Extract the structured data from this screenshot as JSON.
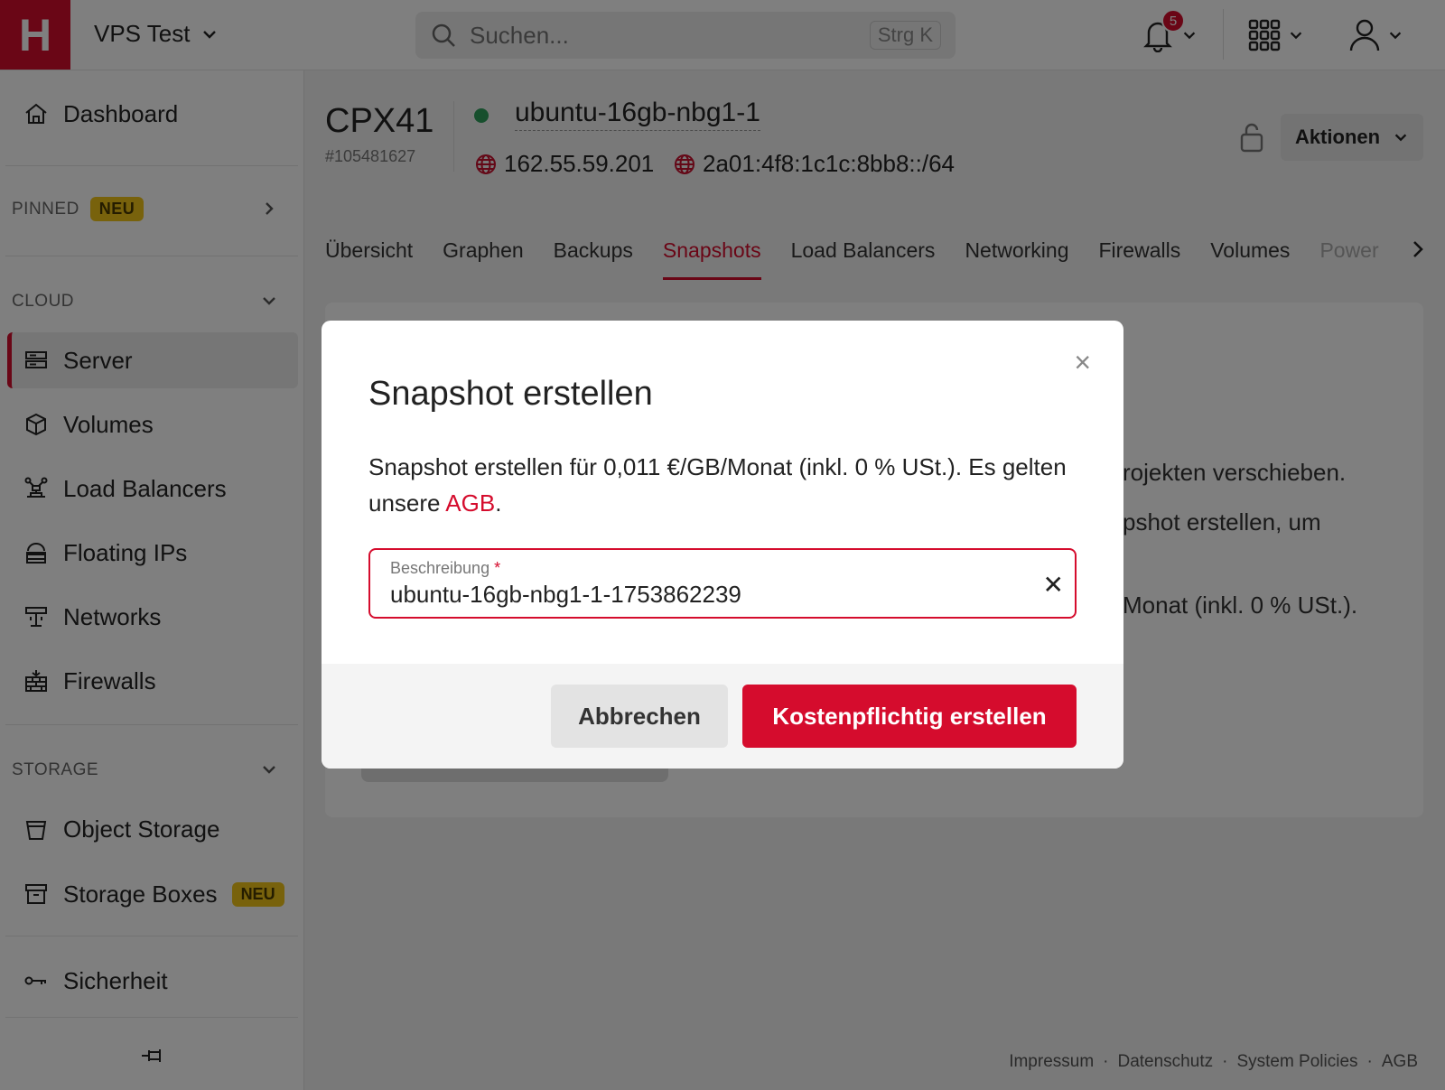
{
  "topbar": {
    "logo_letter": "H",
    "project_name": "VPS Test",
    "search_placeholder": "Suchen...",
    "search_shortcut": "Strg K",
    "notification_count": "5"
  },
  "sidebar": {
    "dashboard": "Dashboard",
    "pinned_label": "PINNED",
    "pinned_badge": "NEU",
    "cloud_label": "CLOUD",
    "cloud_items": [
      "Server",
      "Volumes",
      "Load Balancers",
      "Floating IPs",
      "Networks",
      "Firewalls"
    ],
    "storage_label": "STORAGE",
    "storage_items": [
      "Object Storage",
      "Storage Boxes"
    ],
    "storage_boxes_badge": "NEU",
    "security": "Sicherheit"
  },
  "server": {
    "type": "CPX41",
    "id": "#105481627",
    "name": "ubuntu-16gb-nbg1-1",
    "ipv4": "162.55.59.201",
    "ipv6": "2a01:4f8:1c1c:8bb8::/64",
    "actions_label": "Aktionen"
  },
  "tabs": [
    "Übersicht",
    "Graphen",
    "Backups",
    "Snapshots",
    "Load Balancers",
    "Networking",
    "Firewalls",
    "Volumes",
    "Power"
  ],
  "background_text": {
    "line1": "rojekten verschieben.",
    "line2": "pshot erstellen, um",
    "line3": "Monat (inkl. 0 % USt.)."
  },
  "footer": {
    "impressum": "Impressum",
    "datenschutz": "Datenschutz",
    "system_policies": "System Policies",
    "agb": "AGB",
    "separator": "·"
  },
  "modal": {
    "title": "Snapshot erstellen",
    "text_before": "Snapshot erstellen für 0,011 €/GB/Monat (inkl. 0 % USt.). Es gelten unsere ",
    "agb_link": "AGB",
    "text_after": ".",
    "field_label": "Beschreibung",
    "field_required": "*",
    "field_value": "ubuntu-16gb-nbg1-1-1753862239",
    "cancel_label": "Abbrechen",
    "create_label": "Kostenpflichtig erstellen"
  }
}
